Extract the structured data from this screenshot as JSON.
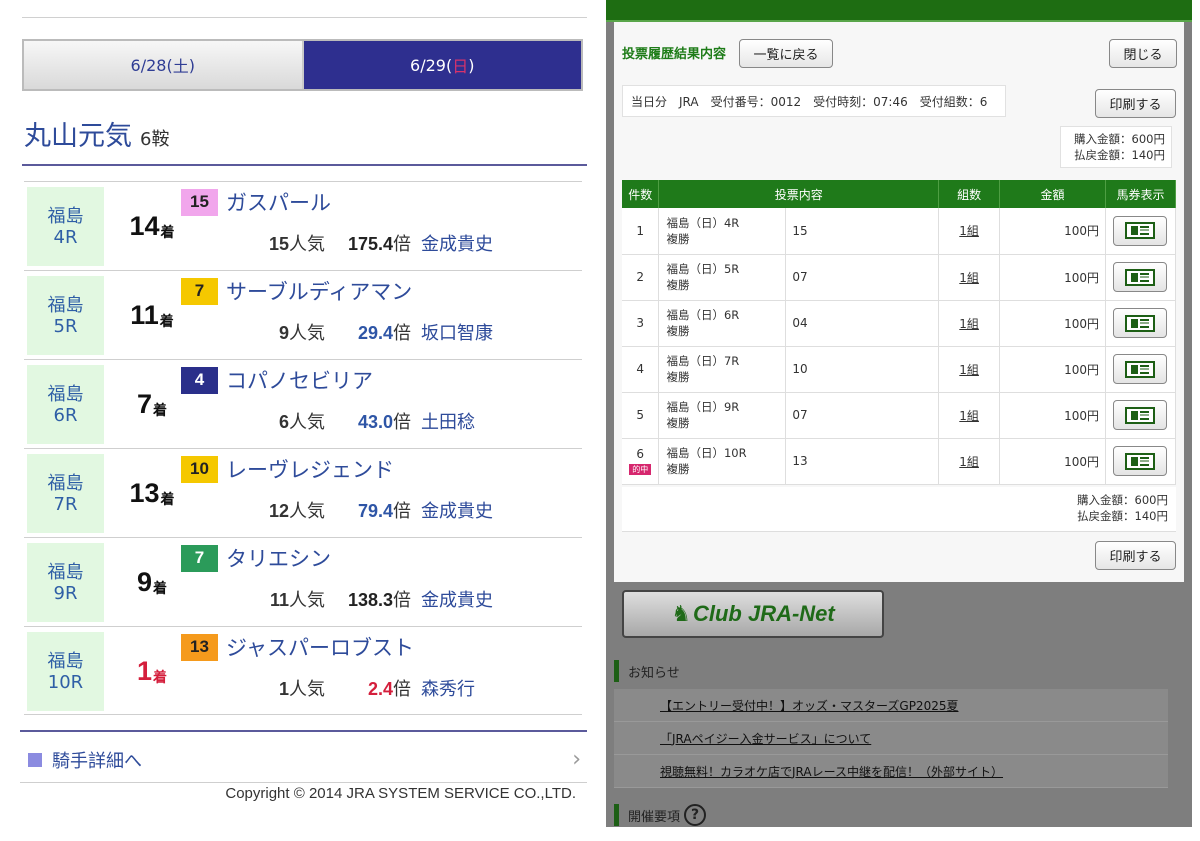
{
  "left": {
    "date_tabs": [
      {
        "label_main": "6/28(",
        "label_day": "土",
        "label_end": ")"
      },
      {
        "label_main": "6/29(",
        "label_day": "日",
        "label_end": ")"
      }
    ],
    "jockey_name": "丸山元気",
    "ride_count": "6鞍",
    "races": [
      {
        "venue": "福島",
        "race": "4R",
        "finish": "14",
        "finish_suffix": "着",
        "gate": "15",
        "gate_bg": "#f1a6ec",
        "gate_fg": "#222222",
        "horse": "ガスパール",
        "pop_num": "15",
        "pop_suffix": "人気",
        "odds": "175.4",
        "odds_suffix": "倍",
        "odds_color": "#222222",
        "rider": "金成貴史"
      },
      {
        "venue": "福島",
        "race": "5R",
        "finish": "11",
        "finish_suffix": "着",
        "gate": "7",
        "gate_bg": "#f5c800",
        "gate_fg": "#222222",
        "horse": "サーブルディアマン",
        "pop_num": "9",
        "pop_suffix": "人気",
        "odds": "29.4",
        "odds_suffix": "倍",
        "odds_color": "#2e55a6",
        "rider": "坂口智康"
      },
      {
        "venue": "福島",
        "race": "6R",
        "finish": "7",
        "finish_suffix": "着",
        "gate": "4",
        "gate_bg": "#2a2f8a",
        "gate_fg": "#ffffff",
        "horse": "コパノセビリア",
        "pop_num": "6",
        "pop_suffix": "人気",
        "odds": "43.0",
        "odds_suffix": "倍",
        "odds_color": "#2e55a6",
        "rider": "土田稔"
      },
      {
        "venue": "福島",
        "race": "7R",
        "finish": "13",
        "finish_suffix": "着",
        "gate": "10",
        "gate_bg": "#f5c800",
        "gate_fg": "#222222",
        "horse": "レーヴレジェンド",
        "pop_num": "12",
        "pop_suffix": "人気",
        "odds": "79.4",
        "odds_suffix": "倍",
        "odds_color": "#2e55a6",
        "rider": "金成貴史"
      },
      {
        "venue": "福島",
        "race": "9R",
        "finish": "9",
        "finish_suffix": "着",
        "gate": "7",
        "gate_bg": "#2b9b5a",
        "gate_fg": "#ffffff",
        "horse": "タリエシン",
        "pop_num": "11",
        "pop_suffix": "人気",
        "odds": "138.3",
        "odds_suffix": "倍",
        "odds_color": "#222222",
        "rider": "金成貴史"
      },
      {
        "venue": "福島",
        "race": "10R",
        "finish": "1",
        "finish_suffix": "着",
        "gate": "13",
        "gate_bg": "#f59a1c",
        "gate_fg": "#222222",
        "horse": "ジャスパーロブスト",
        "pop_num": "1",
        "pop_suffix": "人気",
        "odds": "2.4",
        "odds_suffix": "倍",
        "odds_color": "#d41f3c",
        "rider": "森秀行"
      }
    ],
    "jockey_link": "騎手詳細へ",
    "copyright": "Copyright © 2014 JRA SYSTEM SERVICE CO.,LTD."
  },
  "right": {
    "modal_title": "投票履歴結果内容",
    "back_button": "一覧に戻る",
    "close_button": "閉じる",
    "receipt_info": "当日分　JRA　受付番号：0012　受付時刻：07:46　受付組数：6",
    "print_button": "印刷する",
    "purchase_amount": "購入金額：600円",
    "payout_amount": "払戻金額：140円",
    "table_headers": [
      "件数",
      "投票内容",
      "組数",
      "金額",
      "馬券表示"
    ],
    "bets": [
      {
        "no": "1",
        "race": "福島（日）4R",
        "type": "複勝",
        "content": "15",
        "kumi": "1組",
        "amount": "100円",
        "hit": ""
      },
      {
        "no": "2",
        "race": "福島（日）5R",
        "type": "複勝",
        "content": "07",
        "kumi": "1組",
        "amount": "100円",
        "hit": ""
      },
      {
        "no": "3",
        "race": "福島（日）6R",
        "type": "複勝",
        "content": "04",
        "kumi": "1組",
        "amount": "100円",
        "hit": ""
      },
      {
        "no": "4",
        "race": "福島（日）7R",
        "type": "複勝",
        "content": "10",
        "kumi": "1組",
        "amount": "100円",
        "hit": ""
      },
      {
        "no": "5",
        "race": "福島（日）9R",
        "type": "複勝",
        "content": "07",
        "kumi": "1組",
        "amount": "100円",
        "hit": ""
      },
      {
        "no": "6",
        "race": "福島（日）10R",
        "type": "複勝",
        "content": "13",
        "kumi": "1組",
        "amount": "100円",
        "hit": "的中"
      }
    ],
    "club_button": "Club JRA-Net",
    "news_title": "お知らせ",
    "news": [
      "【エントリー受付中！】オッズ・マスターズGP2025夏",
      "「JRAペイジー入金サービス」について",
      "視聴無料！カラオケ店でJRAレース中継を配信！（外部サイト）"
    ],
    "section_title": "開催要項"
  }
}
